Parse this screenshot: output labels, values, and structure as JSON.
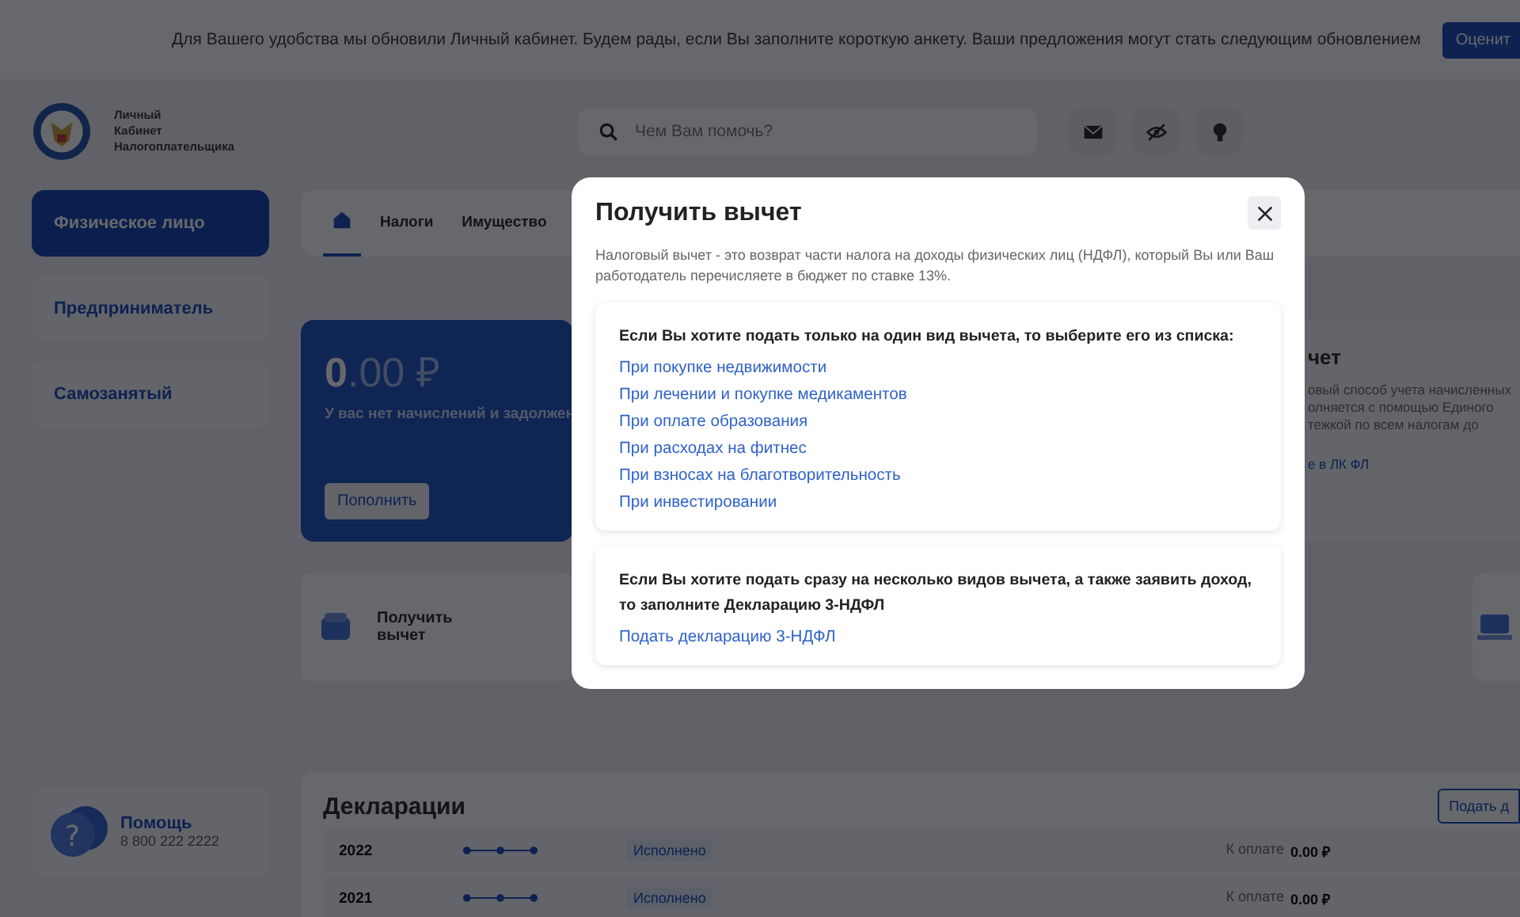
{
  "banner": {
    "text": "Для Вашего удобства мы обновили Личный кабинет. Будем рады, если Вы заполните короткую анкету. Ваши предложения могут стать следующим обновлением",
    "button": "Оценит"
  },
  "header": {
    "logo_lines": [
      "Личный",
      "Кабинет",
      "Налогоплательщика"
    ],
    "search": {
      "placeholder": "Чем Вам помочь?"
    }
  },
  "sidebar": {
    "items": [
      {
        "label": "Физическое лицо",
        "selected": true
      },
      {
        "label": "Предприниматель",
        "selected": false
      },
      {
        "label": "Самозанятый",
        "selected": false
      }
    ],
    "help": {
      "icon": "?",
      "title": "Помощь",
      "phone": "8 800 222 2222"
    }
  },
  "tabs": [
    {
      "kind": "home",
      "selected": true
    },
    {
      "kind": "text",
      "label": "Налоги",
      "selected": false
    },
    {
      "kind": "text",
      "label": "Имущество",
      "selected": false
    }
  ],
  "balance": {
    "amount": "**0**.00 ₽",
    "message": "У вас нет начислений и задолжен",
    "button": "Пополнить"
  },
  "account_card": {
    "title": "чет",
    "lines": [
      "овый способ учета начисленных",
      "олняется с помощью Единого",
      "тежкой по всем налогам до"
    ],
    "link": "е в ЛК ФЛ"
  },
  "quick_actions": [
    {
      "label": "Получить вычет"
    }
  ],
  "declarations": {
    "title": "Декларации",
    "button": "Подать д",
    "rows": [
      {
        "year": "2022",
        "status": "Исполнено",
        "due_label": "К оплате",
        "due_amount": "0.00 ₽"
      },
      {
        "year": "2021",
        "status": "Исполнено",
        "due_label": "К оплате",
        "due_amount": "0.00 ₽"
      }
    ]
  },
  "modal": {
    "title": "Получить вычет",
    "description": "Налоговый вычет - это возврат части налога на доходы физических лиц (НДФЛ), который Вы или Ваш работодатель перечисляете в бюджет по ставке 13%.",
    "single": {
      "heading": "Если Вы хотите подать только на один вид вычета, то выберите его из списка:",
      "links": [
        "При покупке недвижимости",
        "При лечении и покупке медикаментов",
        "При оплате образования",
        "При расходах на фитнес",
        "При взносах на благотворительность",
        "При инвестировании"
      ]
    },
    "multiple": {
      "heading": "Если Вы хотите подать сразу на несколько видов вычета, а также заявить доход, то заполните Декларацию 3-НДФЛ",
      "link": "Подать декларацию 3-НДФЛ"
    }
  }
}
